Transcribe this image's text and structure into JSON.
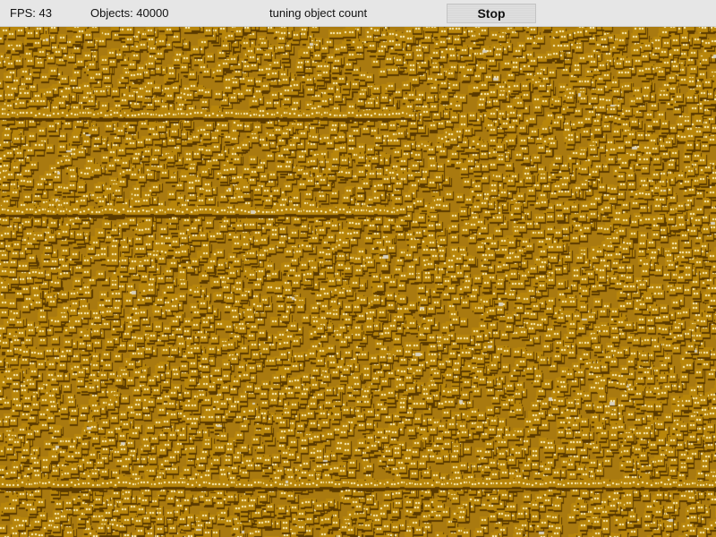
{
  "toolbar": {
    "fps_label": "FPS: 43",
    "objects_label": "Objects: 40000",
    "status_text": "tuning object count",
    "stop_label": "Stop"
  },
  "stage": {
    "fps": 43,
    "object_count": 40000,
    "sprite_colors": {
      "body": "#b8860b",
      "highlight": "#fff3c2",
      "shadow": "#5a3a00",
      "background": "#a97a10"
    }
  }
}
